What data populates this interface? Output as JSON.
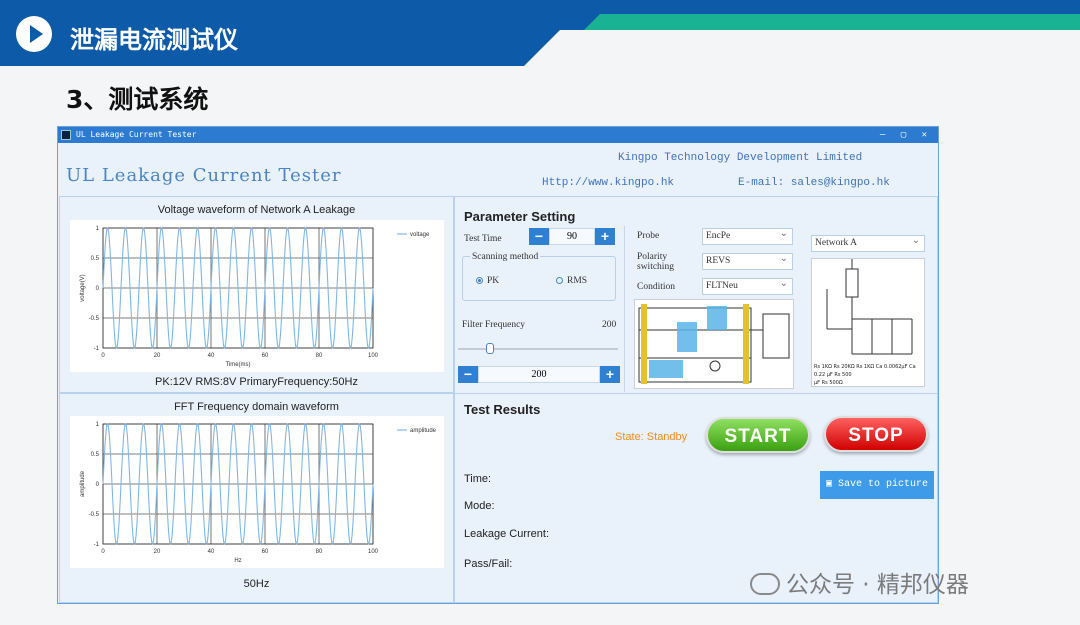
{
  "banner": {
    "title": "泄漏电流测试仪",
    "section": "3、测试系统"
  },
  "window": {
    "title": "UL Leakage Current Tester",
    "app_title": "UL Leakage Current Tester",
    "company": "Kingpo Technology Development Limited",
    "website": "Http://www.kingpo.hk",
    "email": "E-mail: sales@kingpo.hk",
    "controls": "– ▢ ✕"
  },
  "left": {
    "top_chart": {
      "title": "Voltage waveform of Network A Leakage",
      "xlabel": "Time(ms)",
      "ylabel": "voltage(V)",
      "legend": "voltage",
      "info": "PK:12V   RMS:8V   PrimaryFrequency:50Hz"
    },
    "bottom_chart": {
      "title": "FFT Frequency domain waveform",
      "xlabel": "Hz",
      "ylabel": "amplitude",
      "legend": "amplitude",
      "info": "50Hz"
    }
  },
  "chart_data": [
    {
      "type": "line",
      "title": "Voltage waveform of Network A Leakage",
      "xlabel": "Time(ms)",
      "ylabel": "voltage(V)",
      "x_ticks": [
        0,
        20,
        40,
        60,
        80,
        100
      ],
      "y_ticks": [
        1,
        0.5,
        0,
        -0.5,
        -1
      ],
      "xlim": [
        0,
        100
      ],
      "ylim": [
        -1,
        1
      ],
      "grid": true,
      "legend": "top-right",
      "series": [
        {
          "name": "voltage",
          "function": "sin",
          "cycles": 15,
          "amplitude": 1
        }
      ]
    },
    {
      "type": "line",
      "title": "FFT Frequency domain waveform",
      "xlabel": "Hz",
      "ylabel": "amplitude",
      "x_ticks": [
        0,
        20,
        40,
        60,
        80,
        100
      ],
      "y_ticks": [
        1,
        0.5,
        0,
        -0.5,
        -1
      ],
      "xlim": [
        0,
        100
      ],
      "ylim": [
        -1,
        1
      ],
      "grid": true,
      "legend": "top-right",
      "series": [
        {
          "name": "amplitude",
          "function": "sin",
          "cycles": 15,
          "amplitude": 1
        }
      ]
    }
  ],
  "params": {
    "heading": "Parameter Setting",
    "test_time_label": "Test Time",
    "test_time_value": "90",
    "scan_label": "Scanning method",
    "scan_pk": "PK",
    "scan_rms": "RMS",
    "filter_label": "Filter Frequency",
    "filter_value": "200",
    "filter_slider_fraction": 0.2,
    "filter_spin_value": "200",
    "probe_label": "Probe",
    "probe_value": "EncPe",
    "polarity_label": "Polarity\nswitching",
    "polarity_value": "REVS",
    "condition_label": "Condition",
    "condition_value": "FLTNeu",
    "network_value": "Network A",
    "minus": "−",
    "plus": "+",
    "circuit_caption": "Rs 1KΩ Rs 20KΩ Rs 1KΩ Ca 0.0062μF Ca 0.22 μF Rs 500",
    "circuit_caption2": "μF Rs 500Ω"
  },
  "results": {
    "heading": "Test Results",
    "state": "State: Standby",
    "start": "START",
    "stop": "STOP",
    "save": "Save to picture",
    "time": "Time:",
    "mode": "Mode:",
    "leakage": "Leakage Current:",
    "passfail": "Pass/Fail:"
  },
  "watermark": "公众号 · 精邦仪器",
  "colors": {
    "banner": "#0c5aa8",
    "accent_green": "#19b394",
    "wave": "#7fb6e6",
    "start": "#3aa010",
    "stop": "#d00000"
  }
}
